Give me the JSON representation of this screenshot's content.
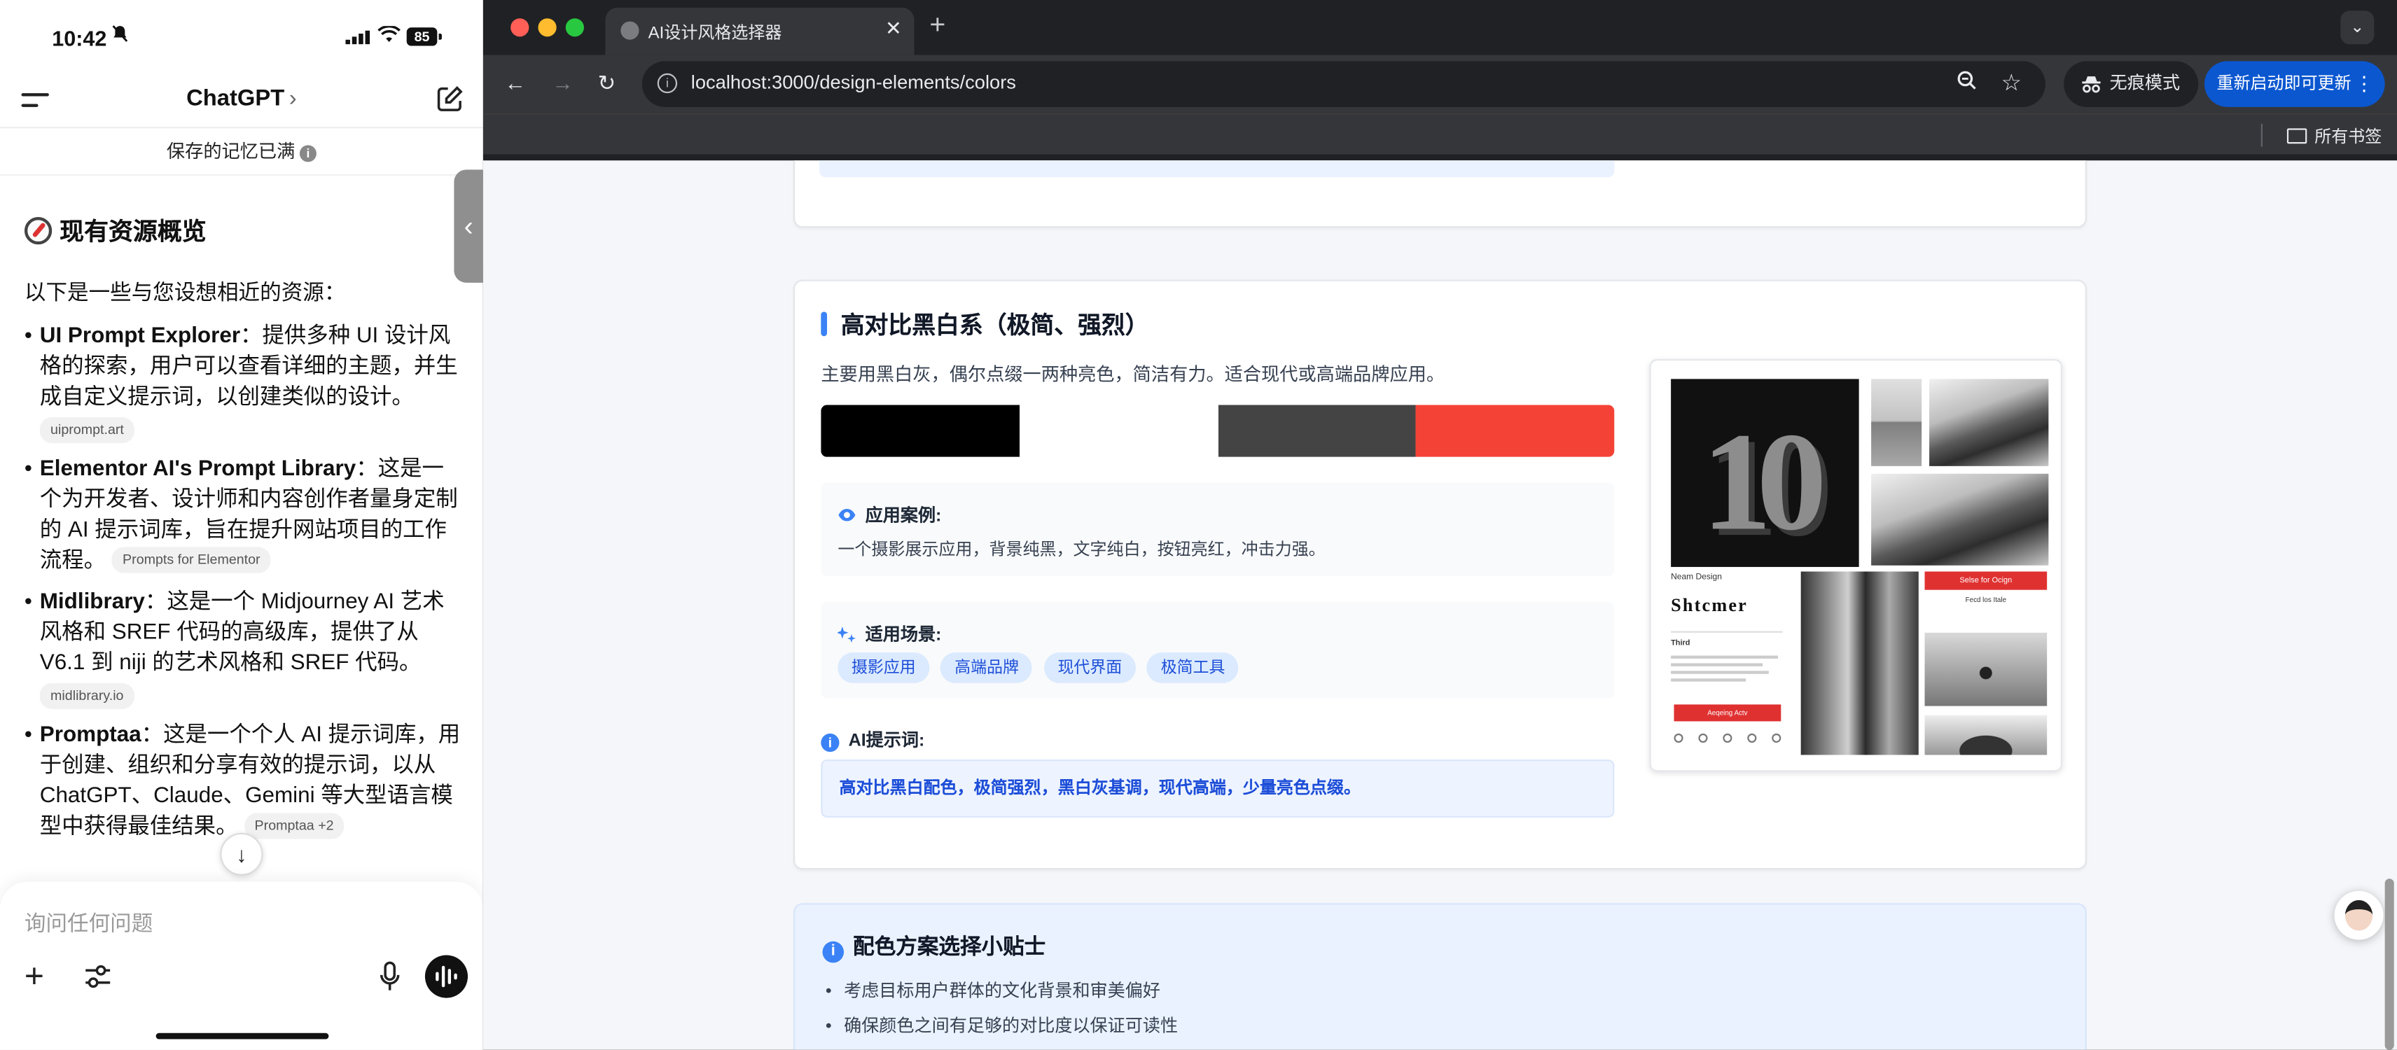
{
  "phone": {
    "status": {
      "time": "10:42",
      "battery": "85"
    },
    "header": {
      "title": "ChatGPT",
      "chevron": "›"
    },
    "memory_notice": "保存的记忆已满",
    "chat": {
      "heading": "现有资源概览",
      "intro": "以下是一些与您设想相近的资源：",
      "items": [
        {
          "name": "UI Prompt Explorer",
          "text": "：提供多种 UI 设计风格的探索，用户可以查看详细的主题，并生成自定义提示词，以创建类似的设计。",
          "chip": "uiprompt.art"
        },
        {
          "name": "Elementor AI's Prompt Library",
          "text": "：这是一个为开发者、设计师和内容创作者量身定制的 AI 提示词库，旨在提升网站项目的工作流程。",
          "chip": "Prompts for Elementor"
        },
        {
          "name": "Midlibrary",
          "text": "：这是一个 Midjourney AI 艺术风格和 SREF 代码的高级库，提供了从 V6.1 到 niji 的艺术风格和 SREF 代码。",
          "chip": "midlibrary.io"
        },
        {
          "name": "Promptaa",
          "text": "：这是一个个人 AI 提示词库，用于创建、组织和分享有效的提示词，以从 ChatGPT、Claude、Gemini 等大型语言模型中获得最佳结果。",
          "chip": "Promptaa +2"
        }
      ]
    },
    "composer": {
      "placeholder": "询问任何问题"
    }
  },
  "browser": {
    "tab_title": "AI设计风格选择器",
    "url": "localhost:3000/design-elements/colors",
    "incognito_label": "无痕模式",
    "update_label": "重新启动即可更新",
    "bookmarks_label": "所有书签"
  },
  "card": {
    "title": "高对比黑白系（极简、强烈）",
    "description": "主要用黑白灰，偶尔点缀一两种亮色，简洁有力。适合现代或高端品牌应用。",
    "swatches": [
      "#000000",
      "#FFFFFF",
      "#444444",
      "#F44336"
    ],
    "case_label": "应用案例:",
    "case_text": "一个摄影展示应用，背景纯黑，文字纯白，按钮亮红，冲击力强。",
    "scene_label": "适用场景:",
    "scene_tags": [
      "摄影应用",
      "高端品牌",
      "现代界面",
      "极简工具"
    ],
    "prompt_label": "AI提示词:",
    "prompt_text": "高对比黑白配色，极简强烈，黑白灰基调，现代高端，少量亮色点缀。",
    "preview": {
      "big_number": "10",
      "app_header": "Neam Design",
      "app_title": "Shtcmer",
      "section": "Third",
      "button": "Aeqeing Actv",
      "red_button": "Selse for Ocign",
      "red_caption": "Fecd los Itale"
    }
  },
  "tips": {
    "title": "配色方案选择小贴士",
    "items": [
      "考虑目标用户群体的文化背景和审美偏好",
      "确保颜色之间有足够的对比度以保证可读性"
    ]
  },
  "colors": {
    "accent": "#3b82f6",
    "tag_bg": "#dbeafe",
    "chrome_dark": "#202124",
    "update_blue": "#0b57d0"
  }
}
